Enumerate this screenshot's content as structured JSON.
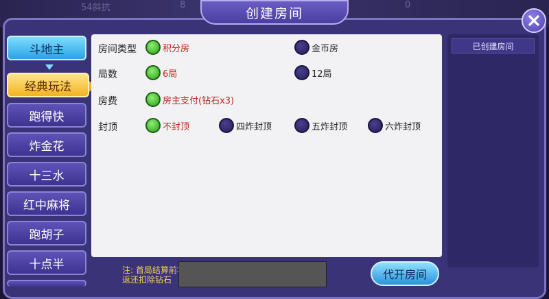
{
  "title": "创建房间",
  "background_blur": {
    "name": "54斜抗",
    "coin1": "8",
    "coin2": "0"
  },
  "sidebar": {
    "items": [
      "斗地主",
      "经典玩法",
      "跑得快",
      "炸金花",
      "十三水",
      "红中麻将",
      "跑胡子",
      "十点半"
    ]
  },
  "options": {
    "room_type": {
      "label": "房间类型",
      "choices": [
        "积分房",
        "金币房"
      ],
      "selected": 0
    },
    "rounds": {
      "label": "局数",
      "choices": [
        "6局",
        "12局"
      ],
      "selected": 0
    },
    "fee": {
      "label": "房费",
      "choices": [
        "房主支付(钻石x3)"
      ],
      "selected": 0
    },
    "cap": {
      "label": "封顶",
      "choices": [
        "不封顶",
        "四炸封顶",
        "五炸封顶",
        "六炸封顶"
      ],
      "selected": 0
    }
  },
  "created_rooms": {
    "header": "已创建房间"
  },
  "footer": {
    "note_line1": "注: 首局结算前将",
    "note_line2": "返还扣除钻石",
    "proxy_button": "代开房间"
  },
  "colors": {
    "selected_text": "#c0231a",
    "accent_blue": "#2aa3e6",
    "accent_yellow": "#f2b321"
  }
}
